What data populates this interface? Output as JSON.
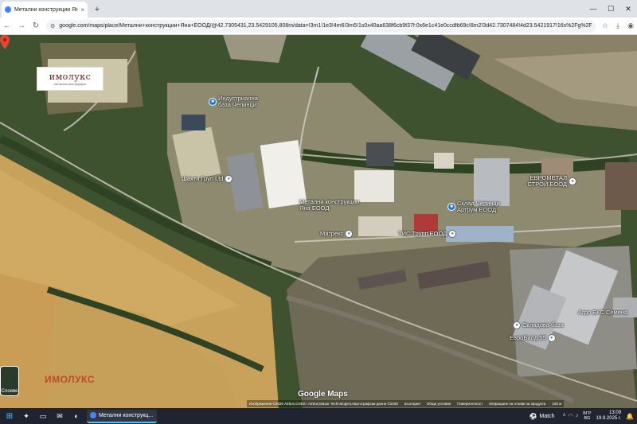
{
  "browser": {
    "tab": {
      "title": "Метални конструкции Яна ЕО",
      "close": "×"
    },
    "new_tab": "+",
    "window_controls": {
      "minimize": "—",
      "maximize": "☐",
      "close": "✕"
    },
    "nav": {
      "back": "←",
      "forward": "→",
      "reload": "↻"
    },
    "url": "google.com/maps/place/Метални+конструкции+Яна+ЕООД/@42.7305431,23.5429105,808m/data=!3m1!1e3!4m6!3m5!1s0x40aa638f6cb9f37f:0x6e1c41e0ccdfb69c!8m2!3d42.7307484!4d23.5421917!16s%2Fg%2F..."
  },
  "map": {
    "logo": {
      "name": "имолукс",
      "subtitle": "метални конструкции"
    },
    "watermark": "ИМОЛУКС",
    "places": [
      {
        "label": "Индустриална база Чепинци"
      },
      {
        "label": "Шахти Груп Ltd"
      },
      {
        "label": "Метални конструкции Яна ЕООД"
      },
      {
        "label": "Склад Чепинци Артрум ЕООД"
      },
      {
        "label": "ЕВРОМЕТАЛ СТРОЙ ЕООД"
      },
      {
        "label": "Матрекс"
      },
      {
        "label": "ТИС Трупп ЕООД"
      },
      {
        "label": "Складова база"
      },
      {
        "label": "ЕвроБилд 55"
      },
      {
        "label": "Агро ЕКС Семена"
      }
    ],
    "layers_label": "Слоеве",
    "google_logo": "Google Maps",
    "attribution": [
      "Изображения ©2025 Airbus,CNES / Airbus,Maxar Technologies,Картографски данни ©2025",
      "България",
      "Общи условия",
      "Поверителност",
      "Изпращане на отзиви за продукта",
      "100 м"
    ]
  },
  "taskbar": {
    "window_title": "Метални конструкц...",
    "weather": "Match",
    "language": {
      "line1": "БГР",
      "line2": "BG"
    },
    "clock": {
      "time": "13:09",
      "date": "19.9.2025 г."
    }
  },
  "colors": {
    "tab_strip": "#dfe3e8",
    "taskbar": "#1f2430",
    "accent_blue": "#1a73e8",
    "pin_red": "#ea4335"
  }
}
